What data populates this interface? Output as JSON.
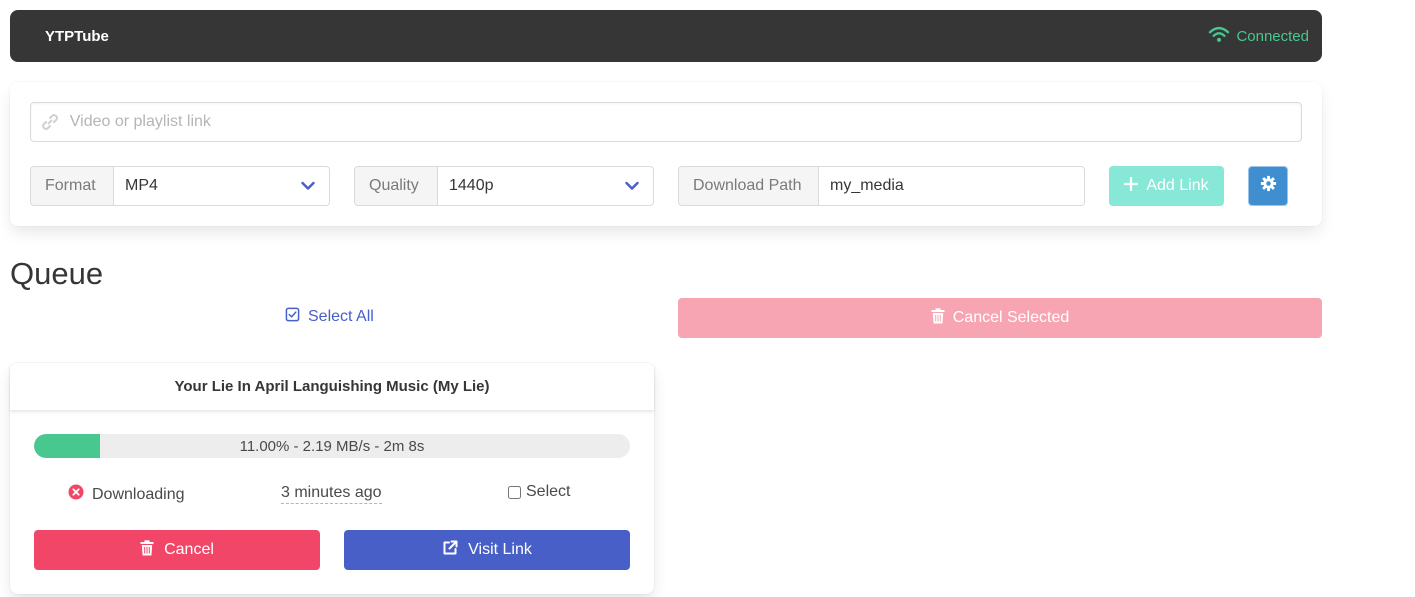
{
  "app": {
    "title": "YTPTube",
    "connection_status": "Connected"
  },
  "form": {
    "url_placeholder": "Video or playlist link",
    "url_value": "",
    "format_label": "Format",
    "format_value": "MP4",
    "quality_label": "Quality",
    "quality_value": "1440p",
    "path_label": "Download Path",
    "path_value": "my_media",
    "add_link_label": "Add Link"
  },
  "queue": {
    "title": "Queue",
    "select_all_label": "Select All",
    "cancel_selected_label": "Cancel Selected",
    "items": [
      {
        "title": "Your Lie In April Languishing Music (My Lie)",
        "progress_percent": 11,
        "progress_text": "11.00% - 2.19 MB/s - 2m 8s",
        "status": "Downloading",
        "time_ago": "3 minutes ago",
        "select_label": "Select",
        "selected": false,
        "cancel_label": "Cancel",
        "visit_label": "Visit Link"
      }
    ]
  },
  "icons": {
    "connection": "wifi-icon",
    "url": "link-icon",
    "dropdown": "chevron-down-icon",
    "add": "plus-icon",
    "settings": "gear-icon",
    "select_all": "check-square-icon",
    "cancel": "trash-icon",
    "status": "error-circle-icon",
    "visit": "external-link-icon"
  },
  "colors": {
    "navbar": "#363636",
    "connected": "#48c78e",
    "primary": "#485fc7",
    "danger": "#f14668",
    "danger_light": "#f7a5b3",
    "success": "#48c78e",
    "add_button": "#88e8d7",
    "info": "#3e8ed0"
  }
}
